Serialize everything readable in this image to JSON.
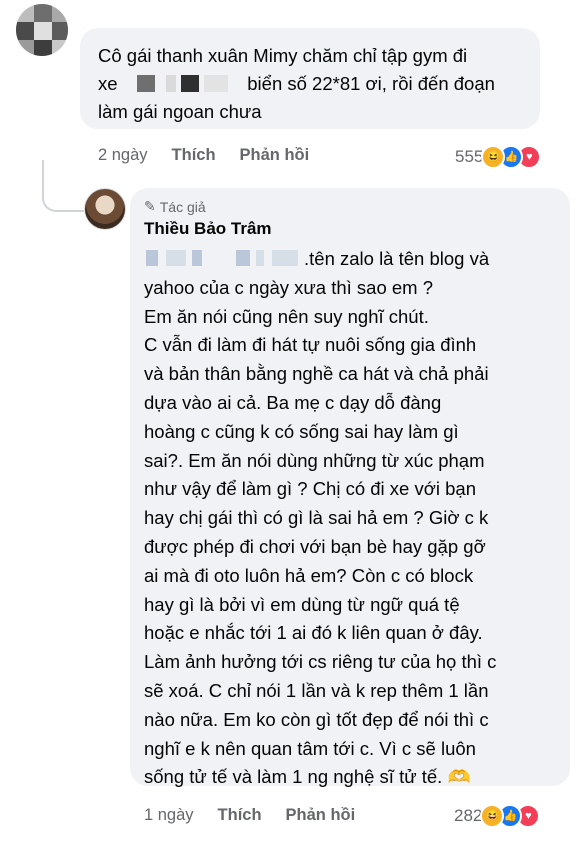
{
  "comment1": {
    "text_line1": "Cô gái thanh xuân Mimy chăm chỉ tập gym đi",
    "text_line2_pre": "xe",
    "text_line2_post": "biển số 22*81 ơi, rồi đến đoạn",
    "text_line3": "làm gái ngoan chưa",
    "time": "2 ngày",
    "like_label": "Thích",
    "reply_label": "Phản hồi",
    "reaction_count": "555",
    "reactions": [
      "haha-icon",
      "like-icon",
      "love-icon"
    ]
  },
  "reply": {
    "badge": "Tác giả",
    "author": "Thiều Bảo Trâm",
    "first_line_tail": ".tên zalo là tên blog và",
    "body": "yahoo của c ngày xưa thì sao em ?\nEm ăn nói cũng nên suy nghĩ chút.\nC vẫn đi làm đi hát tự nuôi sống gia đình\nvà bản thân bằng nghề ca hát và chả phải\ndựa vào ai cả. Ba mẹ c dạy dỗ đàng\nhoàng c cũng k có sống sai hay làm gì\nsai?. Em ăn nói dùng những từ xúc phạm\nnhư vậy để làm gì ? Chị có đi xe với bạn\nhay chị gái thì có gì là sai hả em ? Giờ c k\nđược phép đi chơi với bạn bè hay gặp gỡ\nai mà đi oto luôn hả em? Còn c có block\nhay gì là bởi vì em dùng từ ngữ quá tệ\nhoặc e nhắc tới 1 ai đó k liên quan ở đây.\nLàm ảnh hưởng tới cs riêng tư của họ thì c\nsẽ xoá. C chỉ nói 1 lần và k rep thêm 1 lần\nnào nữa. Em ko còn gì tốt đẹp để nói thì c\nnghĩ e k nên quan tâm tới c. Vì c sẽ luôn\nsống tử tế và làm 1 ng nghệ sĩ tử tế.",
    "end_emoji": "🫶",
    "time": "1 ngày",
    "like_label": "Thích",
    "reply_label": "Phản hồi",
    "reaction_count": "282",
    "reactions": [
      "haha-icon",
      "like-icon",
      "love-icon"
    ]
  },
  "colors": {
    "bubble": "#f0f2f5",
    "meta_text": "#65676b",
    "like_blue": "#1877f2",
    "haha_yellow": "#f7b125",
    "love_red": "#f33e58"
  }
}
